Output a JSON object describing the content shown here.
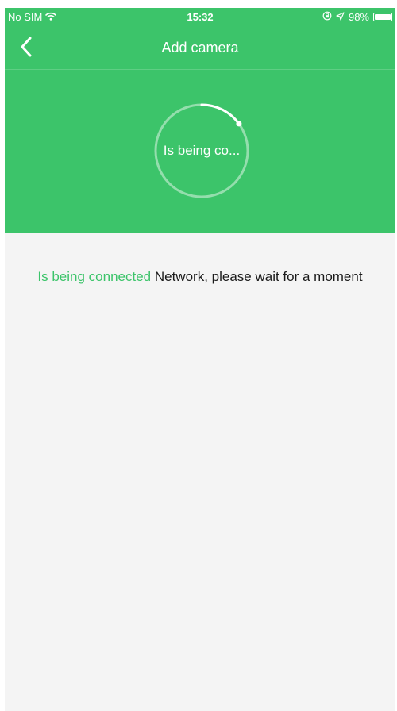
{
  "status_bar": {
    "carrier": "No SIM",
    "time": "15:32",
    "battery": "98%",
    "battery_level": 0.98,
    "wifi_icon": "wifi-icon",
    "lock_icon": "orientation-lock-icon",
    "location_icon": "location-arrow-icon"
  },
  "nav": {
    "title": "Add camera",
    "back_icon": "chevron-left-icon"
  },
  "progress": {
    "label": "Is being co...",
    "fraction": 0.15
  },
  "message": {
    "highlight": "Is being connected",
    "rest": " Network, please wait for a moment"
  },
  "colors": {
    "brand_green": "#3cc46a",
    "background": "#f4f4f4",
    "text": "#1a1a1a"
  }
}
